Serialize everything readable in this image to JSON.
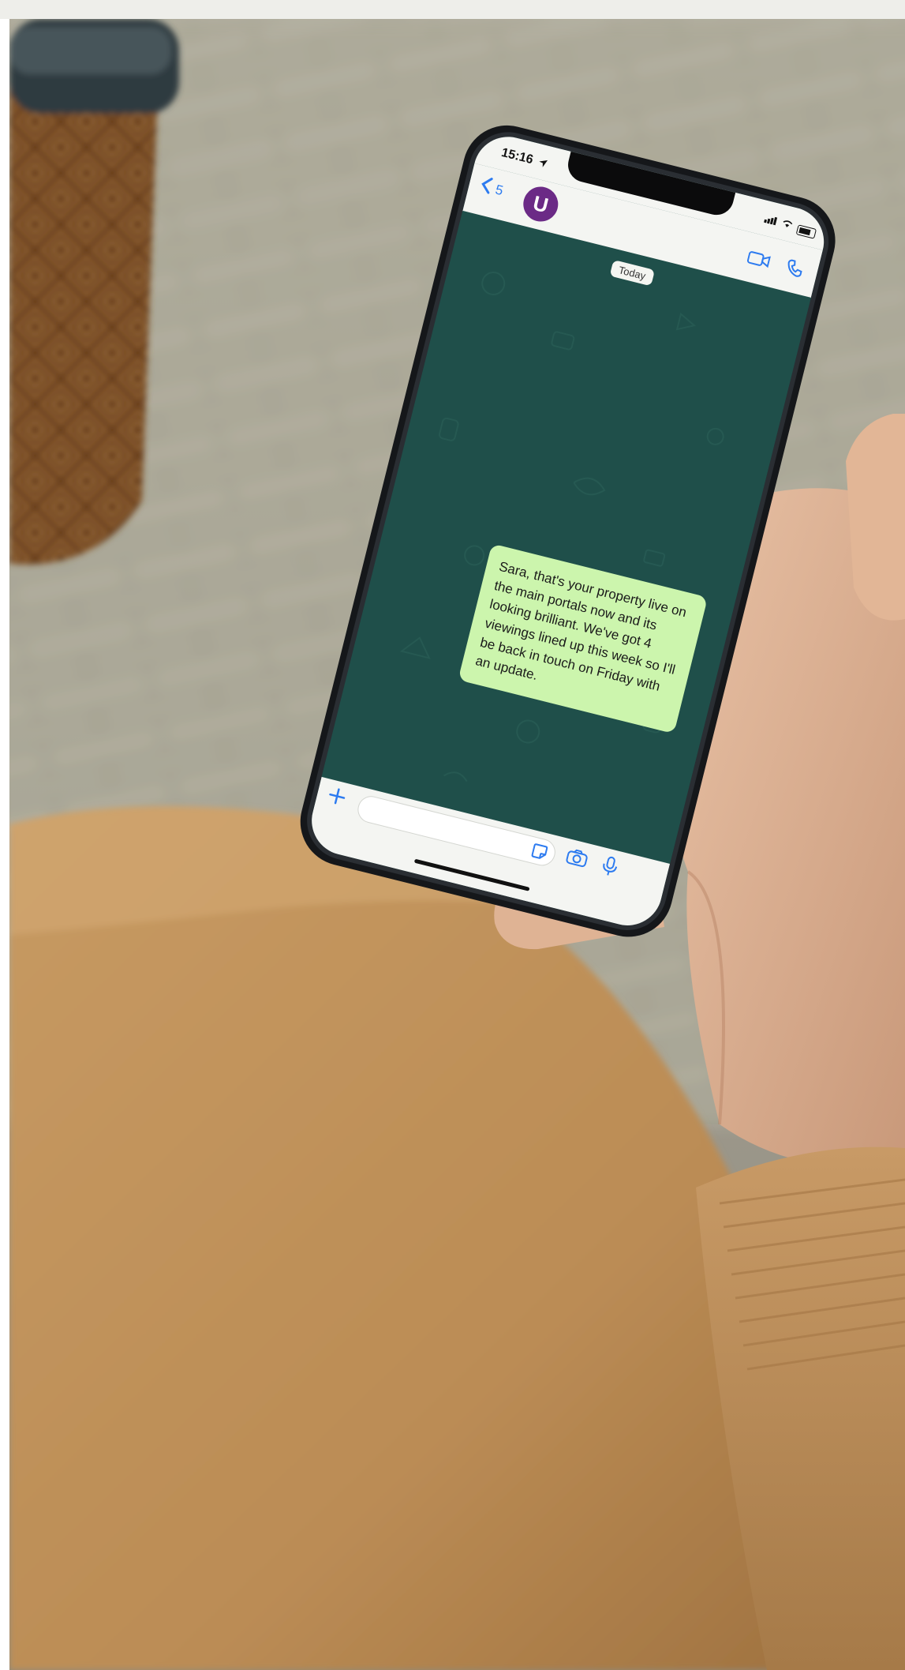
{
  "phone": {
    "status_time": "15:16",
    "back_count": "5",
    "avatar_letter": "U",
    "date_pill": "Today",
    "message": "Sara, that's your property live on the main portals now and its looking brilliant. We've got 4 viewings lined up this week so I'll be back in touch on Friday with an update."
  },
  "colors": {
    "chat_background": "#1f4f4a",
    "outgoing_bubble": "#ccf5ad",
    "accent_blue": "#2d7bf0",
    "avatar_purple": "#6b2a86",
    "sweater": "#c79a62"
  },
  "icons": {
    "back": "chevron-left-icon",
    "video_call": "video-camera-icon",
    "voice_call": "phone-icon",
    "add": "plus-icon",
    "sticker": "sticker-icon",
    "camera": "camera-icon",
    "microphone": "microphone-icon",
    "location": "location-arrow-icon"
  }
}
